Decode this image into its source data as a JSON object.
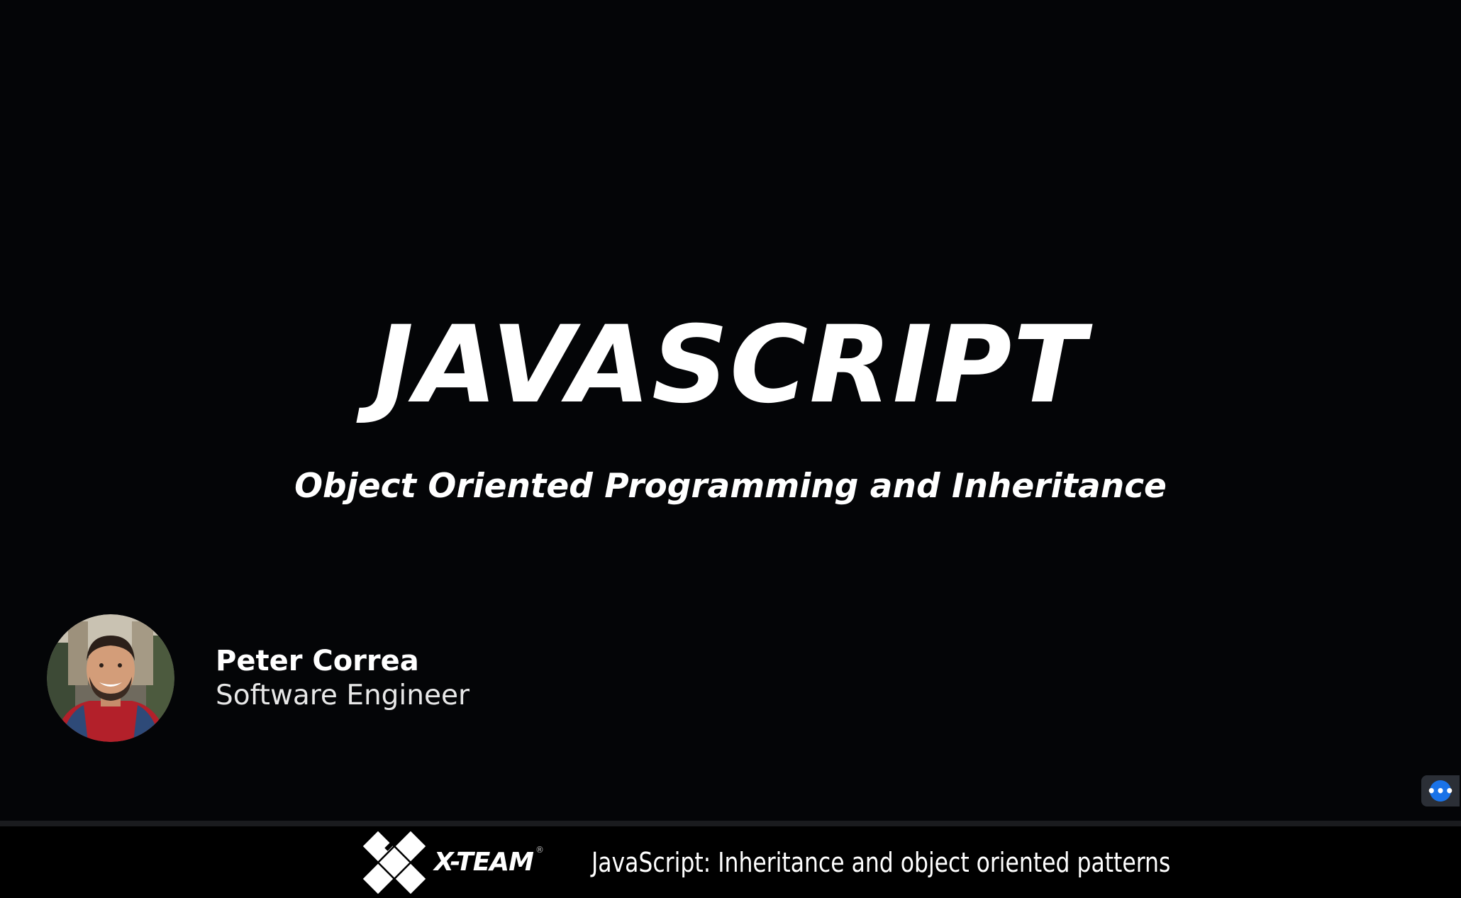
{
  "slide": {
    "title": "JAVASCRIPT",
    "subtitle": "Object Oriented Programming and Inheritance",
    "presenter": {
      "name": "Peter Correa",
      "role": "Software Engineer",
      "avatar_icon": "presenter-photo"
    }
  },
  "chat_button": {
    "icon": "more-dots-icon",
    "glyph": "•••",
    "color": "#1a73e8"
  },
  "banner": {
    "logo_text": "X-TEAM",
    "logo_mark": "®",
    "title": "JavaScript: Inheritance and object oriented patterns"
  },
  "colors": {
    "background": "#040507",
    "text": "#ffffff",
    "banner": "#000000",
    "avatar_jacket": "#b3202a"
  }
}
